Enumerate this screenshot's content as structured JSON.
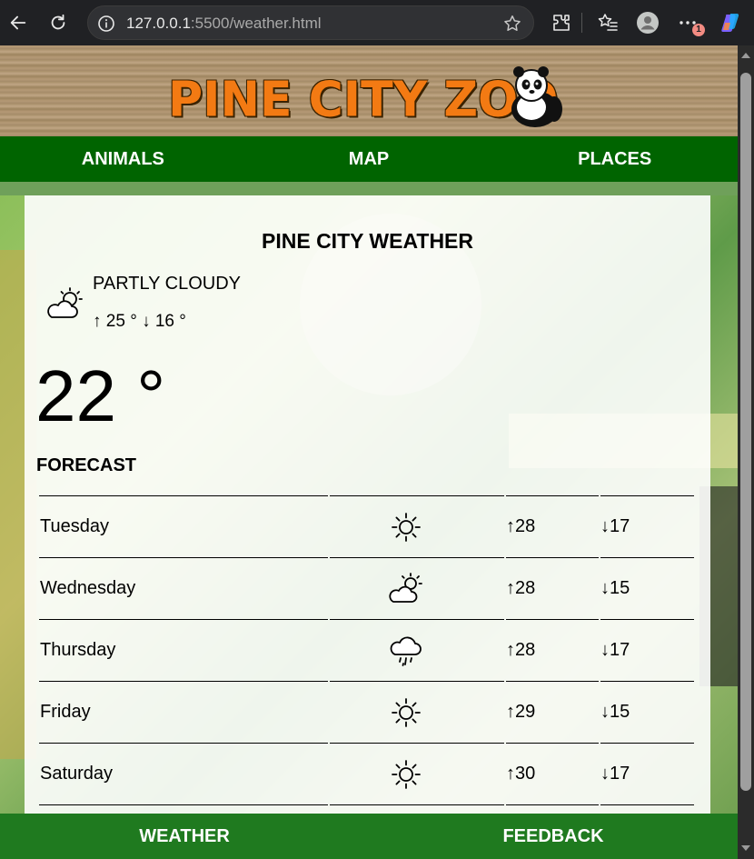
{
  "browser": {
    "url_host": "127.0.0.1",
    "url_path": ":5500/weather.html",
    "badge": "1"
  },
  "site": {
    "logo_text": "PINE CITY ZOO",
    "nav": [
      "ANIMALS",
      "MAP",
      "PLACES"
    ],
    "bottom_nav": [
      "WEATHER",
      "FEEDBACK"
    ]
  },
  "weather": {
    "title": "PINE CITY WEATHER",
    "condition": "PARTLY CLOUDY",
    "high": "↑ 25 °",
    "low": "↓ 16 °",
    "current_temp": "22 °",
    "forecast_title": "FORECAST",
    "forecast": [
      {
        "day": "Tuesday",
        "icon": "sunny-icon",
        "high": "↑28",
        "low": "↓17"
      },
      {
        "day": "Wednesday",
        "icon": "partly-cloudy-icon",
        "high": "↑28",
        "low": "↓15"
      },
      {
        "day": "Thursday",
        "icon": "rain-icon",
        "high": "↑28",
        "low": "↓17"
      },
      {
        "day": "Friday",
        "icon": "sunny-icon",
        "high": "↑29",
        "low": "↓15"
      },
      {
        "day": "Saturday",
        "icon": "sunny-icon",
        "high": "↑30",
        "low": "↓17"
      }
    ]
  },
  "colors": {
    "nav_green": "#006400",
    "bottom_nav_green": "#1f7a1f",
    "logo_orange": "#f37a13"
  }
}
